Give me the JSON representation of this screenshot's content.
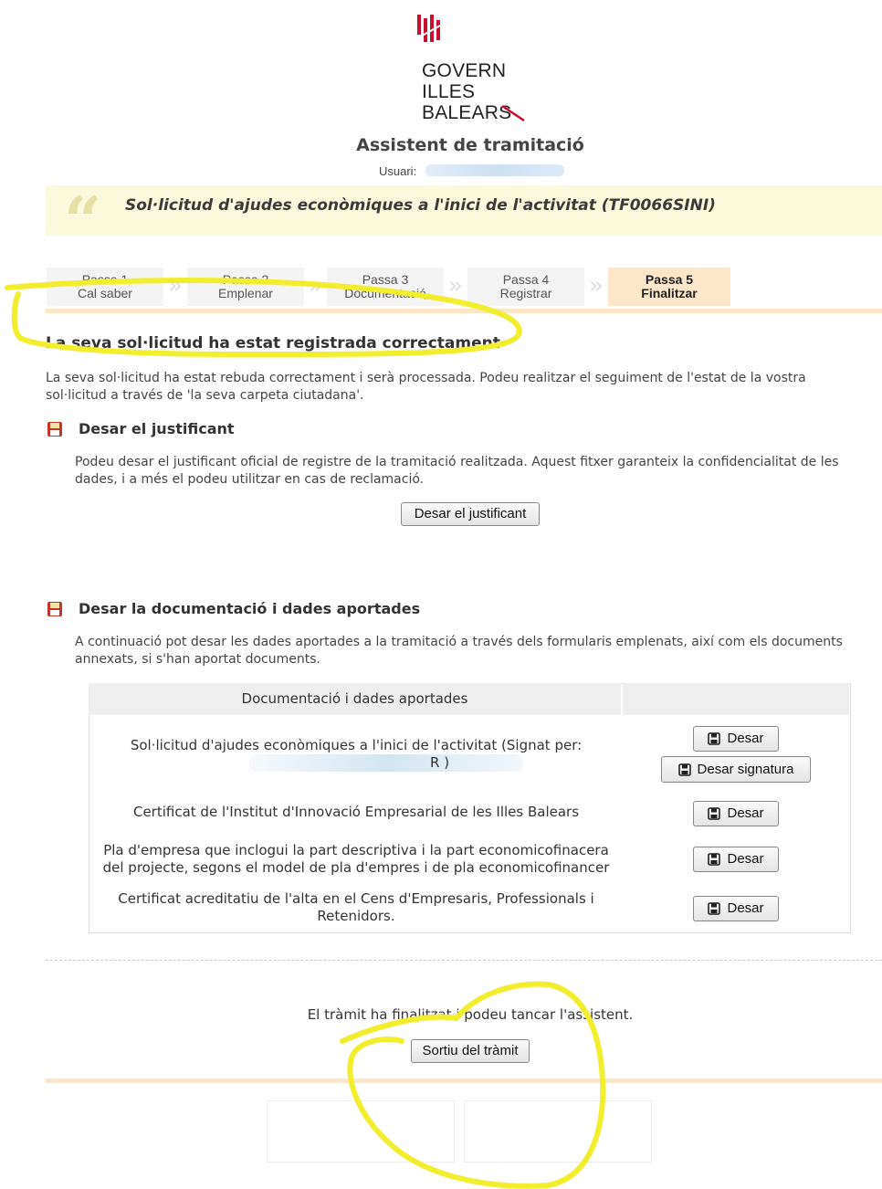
{
  "header": {
    "logo_lines": [
      "GOVERN",
      "ILLES",
      "BALEARS"
    ],
    "app_title": "Assistent de tramitació",
    "user_label": "Usuari:",
    "procedure_title": "Sol·licitud d'ajudes econòmiques a l'inici de l'activitat (TF0066SINI)"
  },
  "steps": [
    {
      "label": "Passa 1",
      "sub": "Cal saber",
      "active": false
    },
    {
      "label": "Passa 2",
      "sub": "Emplenar",
      "active": false
    },
    {
      "label": "Passa 3",
      "sub": "Documentació",
      "active": false
    },
    {
      "label": "Passa 4",
      "sub": "Registrar",
      "active": false
    },
    {
      "label": "Passa 5",
      "sub": "Finalitzar",
      "active": true
    }
  ],
  "main": {
    "heading": "La seva sol·licitud ha estat registrada correctament",
    "intro": "La seva sol·licitud ha estat rebuda correctament i serà processada. Podeu realitzar el seguiment de l'estat de la vostra sol·licitud a través de 'la seva carpeta ciutadana'.",
    "justificant": {
      "title": "Desar el justificant",
      "text": "Podeu desar el justificant oficial de registre de la tramitació realitzada. Aquest fitxer garanteix la confidencialitat de les dades, i a més el podeu utilitzar en cas de reclamació.",
      "button": "Desar el justificant"
    },
    "documentacio": {
      "title": "Desar la documentació i dades aportades",
      "text": "A continuació pot desar les dades aportades a la tramitació a través dels formularis emplenats, així com els documents annexats, si s'han aportat documents.",
      "table_header": "Documentació i dades aportades",
      "rows": [
        {
          "text_line1": "Sol·licitud d'ajudes econòmiques a l'inici de l'activitat (Signat per:",
          "text_line2_suffix": "R )"
        },
        {
          "text_line1": "Certificat de l'Institut d'Innovació Empresarial de les Illes Balears"
        },
        {
          "text_line1": "Pla d'empresa que inclogui la part descriptiva i la part economicofinacera",
          "text_line2": "del projecte, segons el model de pla d'empres i de pla economicofinancer"
        },
        {
          "text_line1": "Certificat acreditatiu de l'alta en el Cens d'Empresaris, Professionals i",
          "text_line2": "Retenidors."
        }
      ],
      "btn_desar": "Desar",
      "btn_signatura": "Desar signatura"
    },
    "end_text": "El tràmit ha finalitzat i podeu tancar l'assistent.",
    "exit_button": "Sortiu del tràmit"
  },
  "colors": {
    "accent": "#fde7c8",
    "banner": "#fbf9dc",
    "logo_red": "#c8102e",
    "annotation": "#f5f03c"
  },
  "icons": {
    "save": "floppy-disk-icon",
    "quote": "quote-icon"
  }
}
